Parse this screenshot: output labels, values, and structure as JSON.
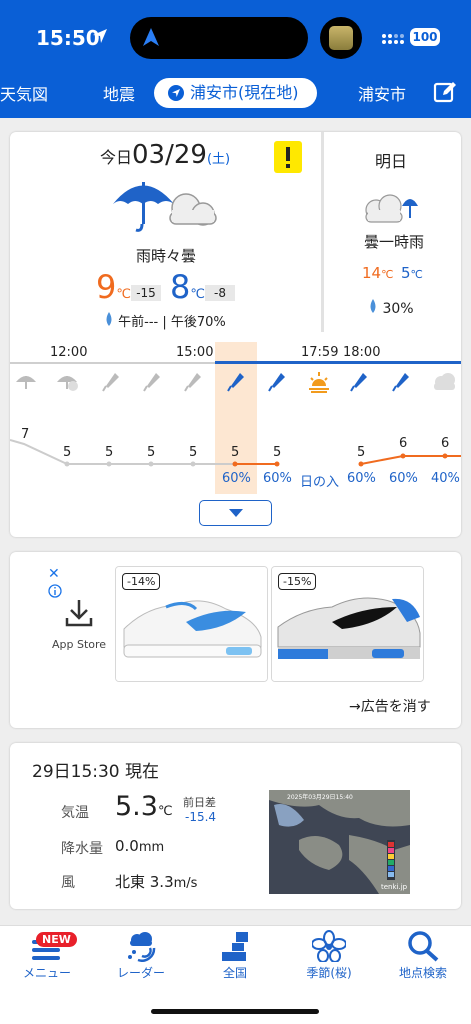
{
  "status_bar": {
    "time": "15:50",
    "battery": "100"
  },
  "tabs": {
    "items": [
      "天気図",
      "地震",
      "浦安市(現在地)",
      "浦安市"
    ],
    "active": "浦安市(現在地)"
  },
  "today": {
    "prefix": "今日",
    "date": "03/29",
    "weekday": "(土)",
    "weather": "雨時々曇",
    "high": "9",
    "high_diff": "-15",
    "low": "8",
    "low_diff": "-8",
    "temp_unit": "℃",
    "rain": "午前--- | 午後70%"
  },
  "tomorrow": {
    "label": "明日",
    "weather": "曇一時雨",
    "high": "14",
    "low": "5",
    "temp_unit": "℃",
    "rain": "30%"
  },
  "hourly": {
    "time_labels": [
      "12:00",
      "15:00",
      "17:59",
      "18:00"
    ],
    "temps": [
      "7",
      "5",
      "5",
      "5",
      "5",
      "5",
      "5",
      "5",
      "6",
      "6"
    ],
    "precip": [
      "60%",
      "60%",
      "日の入",
      "60%",
      "60%",
      "40%"
    ],
    "icons": [
      "rain-umbrella-icon",
      "cloud-rain-umbrella-icon",
      "closed-umbrella-icon",
      "closed-umbrella-icon",
      "closed-umbrella-icon",
      "closed-umbrella-icon",
      "closed-umbrella-icon",
      "sunset-icon",
      "closed-umbrella-icon",
      "closed-umbrella-icon",
      "cloud-icon"
    ]
  },
  "ad": {
    "app_label": "App Store",
    "products": [
      {
        "badge": "-14%"
      },
      {
        "badge": "-15%"
      }
    ],
    "remove_label": "→広告を消す"
  },
  "current": {
    "title": "29日15:30 現在",
    "temp_label": "気温",
    "temp_value": "5.3",
    "temp_unit": "℃",
    "prev_label": "前日差",
    "prev_value": "-15.4",
    "precip_label": "降水量",
    "precip_value": "0.0",
    "precip_unit": "mm",
    "wind_label": "風",
    "wind_value": "北東 3.3",
    "wind_unit": "m/s",
    "radar_caption": "2025年03月29日15:40",
    "radar_brand": "tenki.jp"
  },
  "bottom_nav": {
    "items": [
      "メニュー",
      "レーダー",
      "全国",
      "季節(桜)",
      "地点検索"
    ],
    "new_badge": "NEW"
  },
  "colors": {
    "brand": "#0a5fd6",
    "high": "#f06b1f",
    "low": "#1f63c8"
  }
}
